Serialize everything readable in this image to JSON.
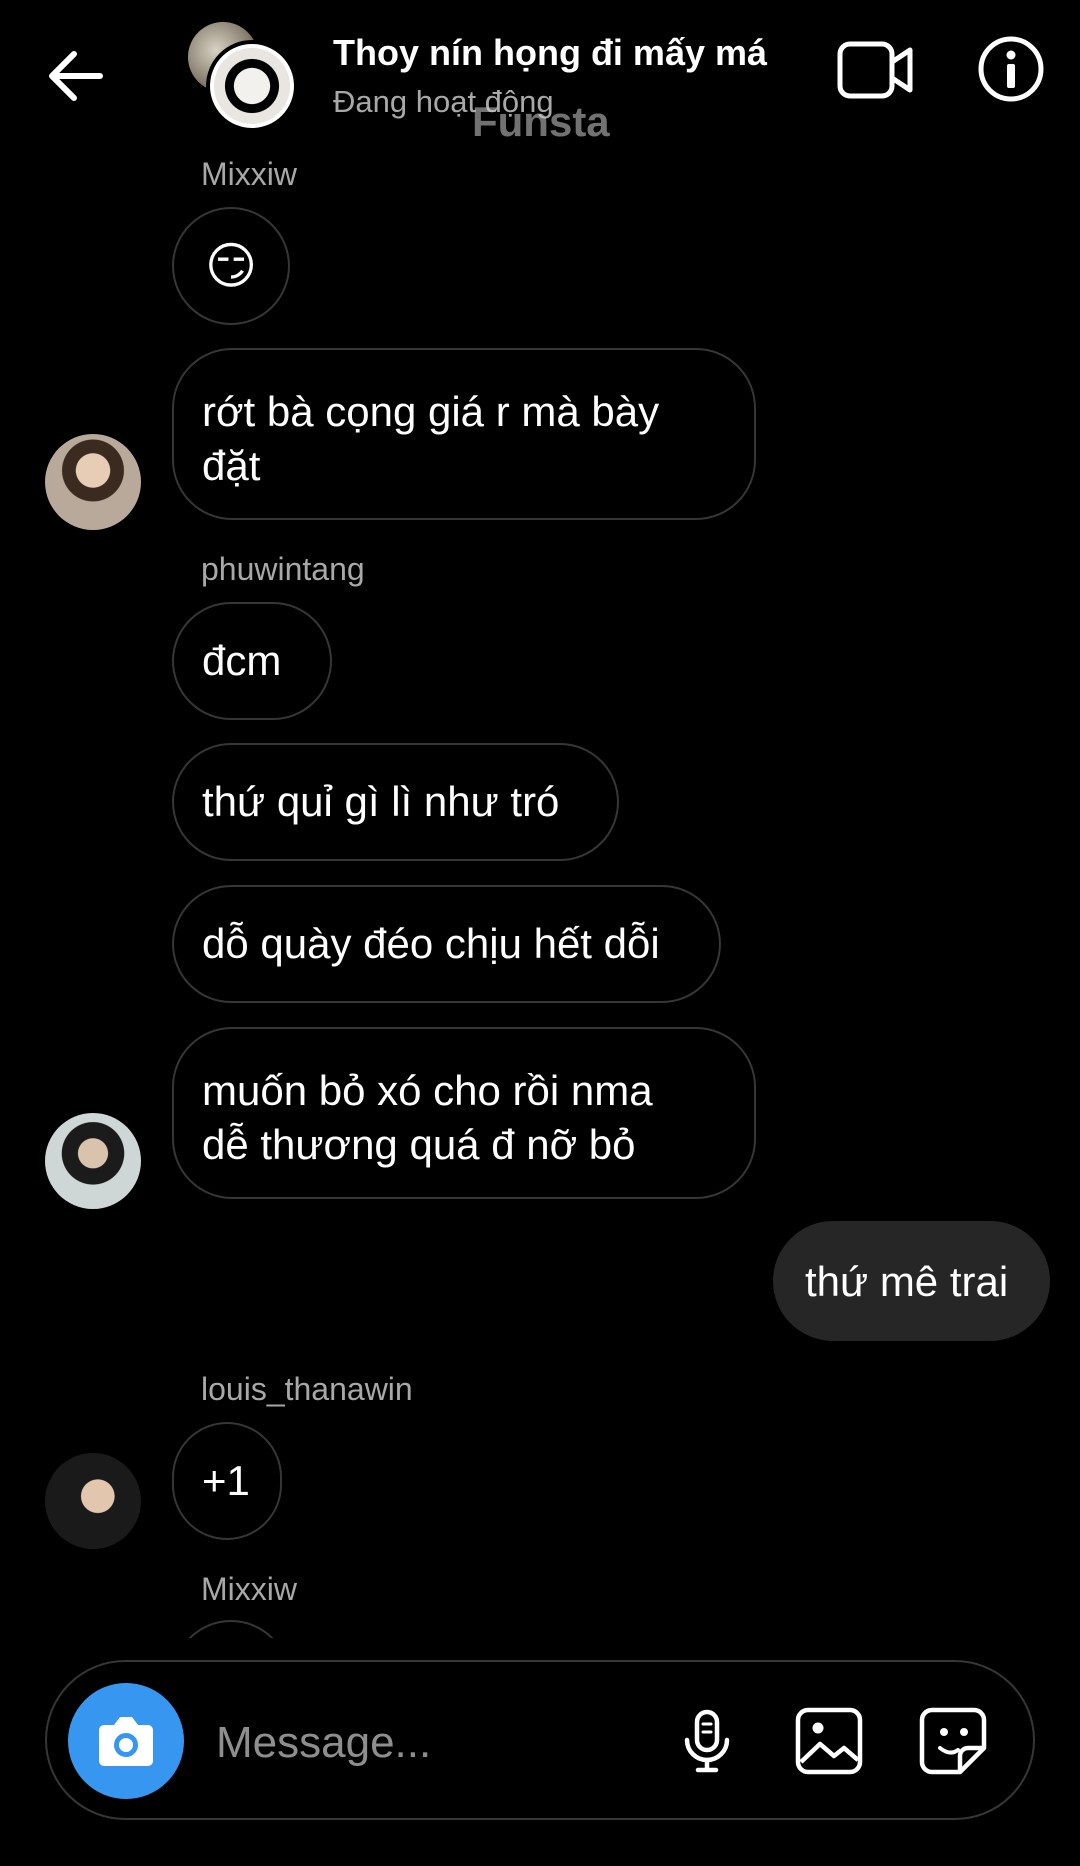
{
  "header": {
    "title": "Thoy nín họng đi mấy má",
    "status": "Đang hoạt động",
    "watermark": "Funsta"
  },
  "messages": {
    "m1_sender": "Mixxiw",
    "m1_emoji": "😏",
    "m2_text_l1": "rớt bà cọng giá r mà bày",
    "m2_text_l2": "đặt",
    "m3_sender": "phuwintang",
    "m3_text": "đcm",
    "m4_text": "thứ quỉ gì lì như tró",
    "m5_text": "dỗ quày đéo chịu hết dỗi",
    "m6_text_l1": "muốn bỏ xó cho rồi nma",
    "m6_text_l2": "dễ thương quá đ nỡ bỏ",
    "m7_text": "thứ mê trai",
    "m8_sender": "louis_thanawin",
    "m8_text": "+1",
    "m9_sender": "Mixxiw"
  },
  "composer": {
    "placeholder": "Message..."
  },
  "icons": [
    "back-arrow-icon",
    "video-call-icon",
    "info-icon",
    "camera-icon",
    "microphone-icon",
    "gallery-icon",
    "sticker-icon"
  ],
  "colors": {
    "background": "#000000",
    "camera_button": "#3797f0",
    "outgoing_bubble": "#262626",
    "bubble_border": "#363636",
    "secondary_text": "#a8a8a8"
  }
}
